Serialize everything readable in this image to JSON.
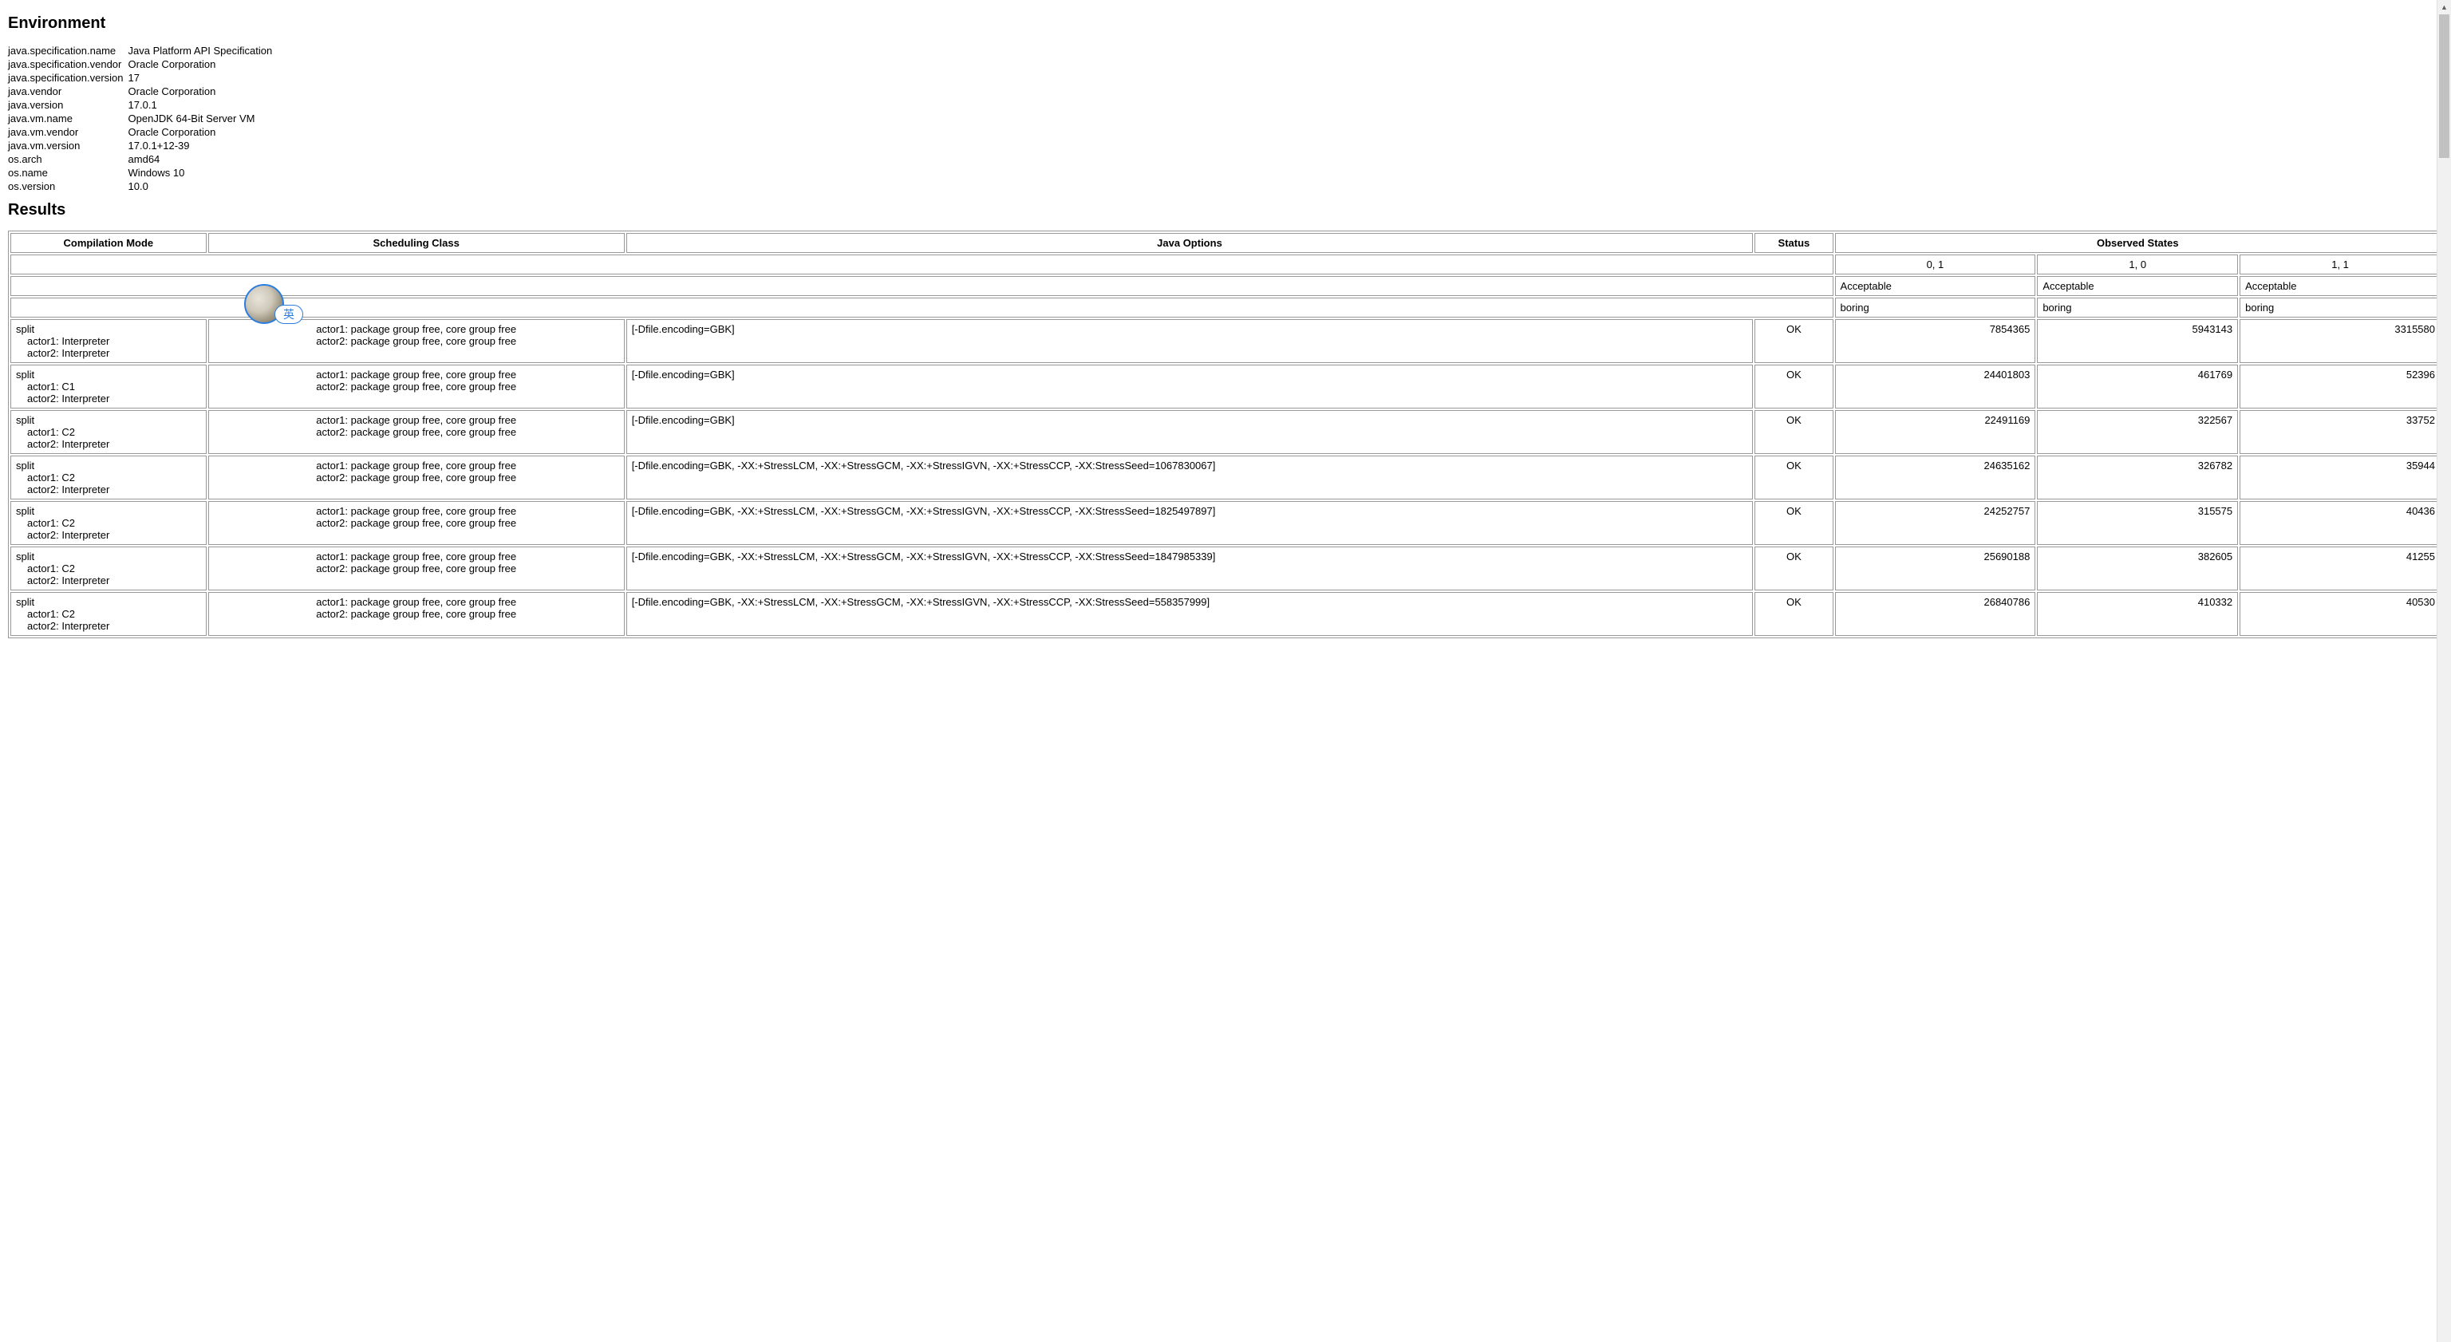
{
  "sections": {
    "environment": "Environment",
    "results": "Results"
  },
  "environment": [
    {
      "k": "java.specification.name",
      "v": "Java Platform API Specification"
    },
    {
      "k": "java.specification.vendor",
      "v": "Oracle Corporation"
    },
    {
      "k": "java.specification.version",
      "v": "17"
    },
    {
      "k": "java.vendor",
      "v": "Oracle Corporation"
    },
    {
      "k": "java.version",
      "v": "17.0.1"
    },
    {
      "k": "java.vm.name",
      "v": "OpenJDK 64-Bit Server VM"
    },
    {
      "k": "java.vm.vendor",
      "v": "Oracle Corporation"
    },
    {
      "k": "java.vm.version",
      "v": "17.0.1+12-39"
    },
    {
      "k": "os.arch",
      "v": "amd64"
    },
    {
      "k": "os.name",
      "v": "Windows 10"
    },
    {
      "k": "os.version",
      "v": "10.0"
    }
  ],
  "results": {
    "headers": {
      "compilation_mode": "Compilation Mode",
      "scheduling_class": "Scheduling Class",
      "java_options": "Java Options",
      "status": "Status",
      "observed_states": "Observed States"
    },
    "observed_columns": [
      "0, 1",
      "1, 0",
      "1, 1"
    ],
    "accept_row": [
      "Acceptable",
      "Acceptable",
      "Acceptable"
    ],
    "boring_row": [
      "boring",
      "boring",
      "boring"
    ],
    "rows": [
      {
        "cm": [
          "split",
          "actor1: Interpreter",
          "actor2: Interpreter"
        ],
        "sched": [
          "actor1: package group free, core group free",
          "actor2: package group free, core group free"
        ],
        "opts": "[-Dfile.encoding=GBK]",
        "status": "OK",
        "obs": [
          "7854365",
          "5943143",
          "3315580"
        ]
      },
      {
        "cm": [
          "split",
          "actor1: C1",
          "actor2: Interpreter"
        ],
        "sched": [
          "actor1: package group free, core group free",
          "actor2: package group free, core group free"
        ],
        "opts": "[-Dfile.encoding=GBK]",
        "status": "OK",
        "obs": [
          "24401803",
          "461769",
          "52396"
        ]
      },
      {
        "cm": [
          "split",
          "actor1: C2",
          "actor2: Interpreter"
        ],
        "sched": [
          "actor1: package group free, core group free",
          "actor2: package group free, core group free"
        ],
        "opts": "[-Dfile.encoding=GBK]",
        "status": "OK",
        "obs": [
          "22491169",
          "322567",
          "33752"
        ]
      },
      {
        "cm": [
          "split",
          "actor1: C2",
          "actor2: Interpreter"
        ],
        "sched": [
          "actor1: package group free, core group free",
          "actor2: package group free, core group free"
        ],
        "opts": "[-Dfile.encoding=GBK, -XX:+StressLCM, -XX:+StressGCM, -XX:+StressIGVN, -XX:+StressCCP, -XX:StressSeed=1067830067]",
        "status": "OK",
        "obs": [
          "24635162",
          "326782",
          "35944"
        ]
      },
      {
        "cm": [
          "split",
          "actor1: C2",
          "actor2: Interpreter"
        ],
        "sched": [
          "actor1: package group free, core group free",
          "actor2: package group free, core group free"
        ],
        "opts": "[-Dfile.encoding=GBK, -XX:+StressLCM, -XX:+StressGCM, -XX:+StressIGVN, -XX:+StressCCP, -XX:StressSeed=1825497897]",
        "status": "OK",
        "obs": [
          "24252757",
          "315575",
          "40436"
        ]
      },
      {
        "cm": [
          "split",
          "actor1: C2",
          "actor2: Interpreter"
        ],
        "sched": [
          "actor1: package group free, core group free",
          "actor2: package group free, core group free"
        ],
        "opts": "[-Dfile.encoding=GBK, -XX:+StressLCM, -XX:+StressGCM, -XX:+StressIGVN, -XX:+StressCCP, -XX:StressSeed=1847985339]",
        "status": "OK",
        "obs": [
          "25690188",
          "382605",
          "41255"
        ]
      },
      {
        "cm": [
          "split",
          "actor1: C2",
          "actor2: Interpreter"
        ],
        "sched": [
          "actor1: package group free, core group free",
          "actor2: package group free, core group free"
        ],
        "opts": "[-Dfile.encoding=GBK, -XX:+StressLCM, -XX:+StressGCM, -XX:+StressIGVN, -XX:+StressCCP, -XX:StressSeed=558357999]",
        "status": "OK",
        "obs": [
          "26840786",
          "410332",
          "40530"
        ]
      }
    ]
  },
  "ime_badge": "英"
}
